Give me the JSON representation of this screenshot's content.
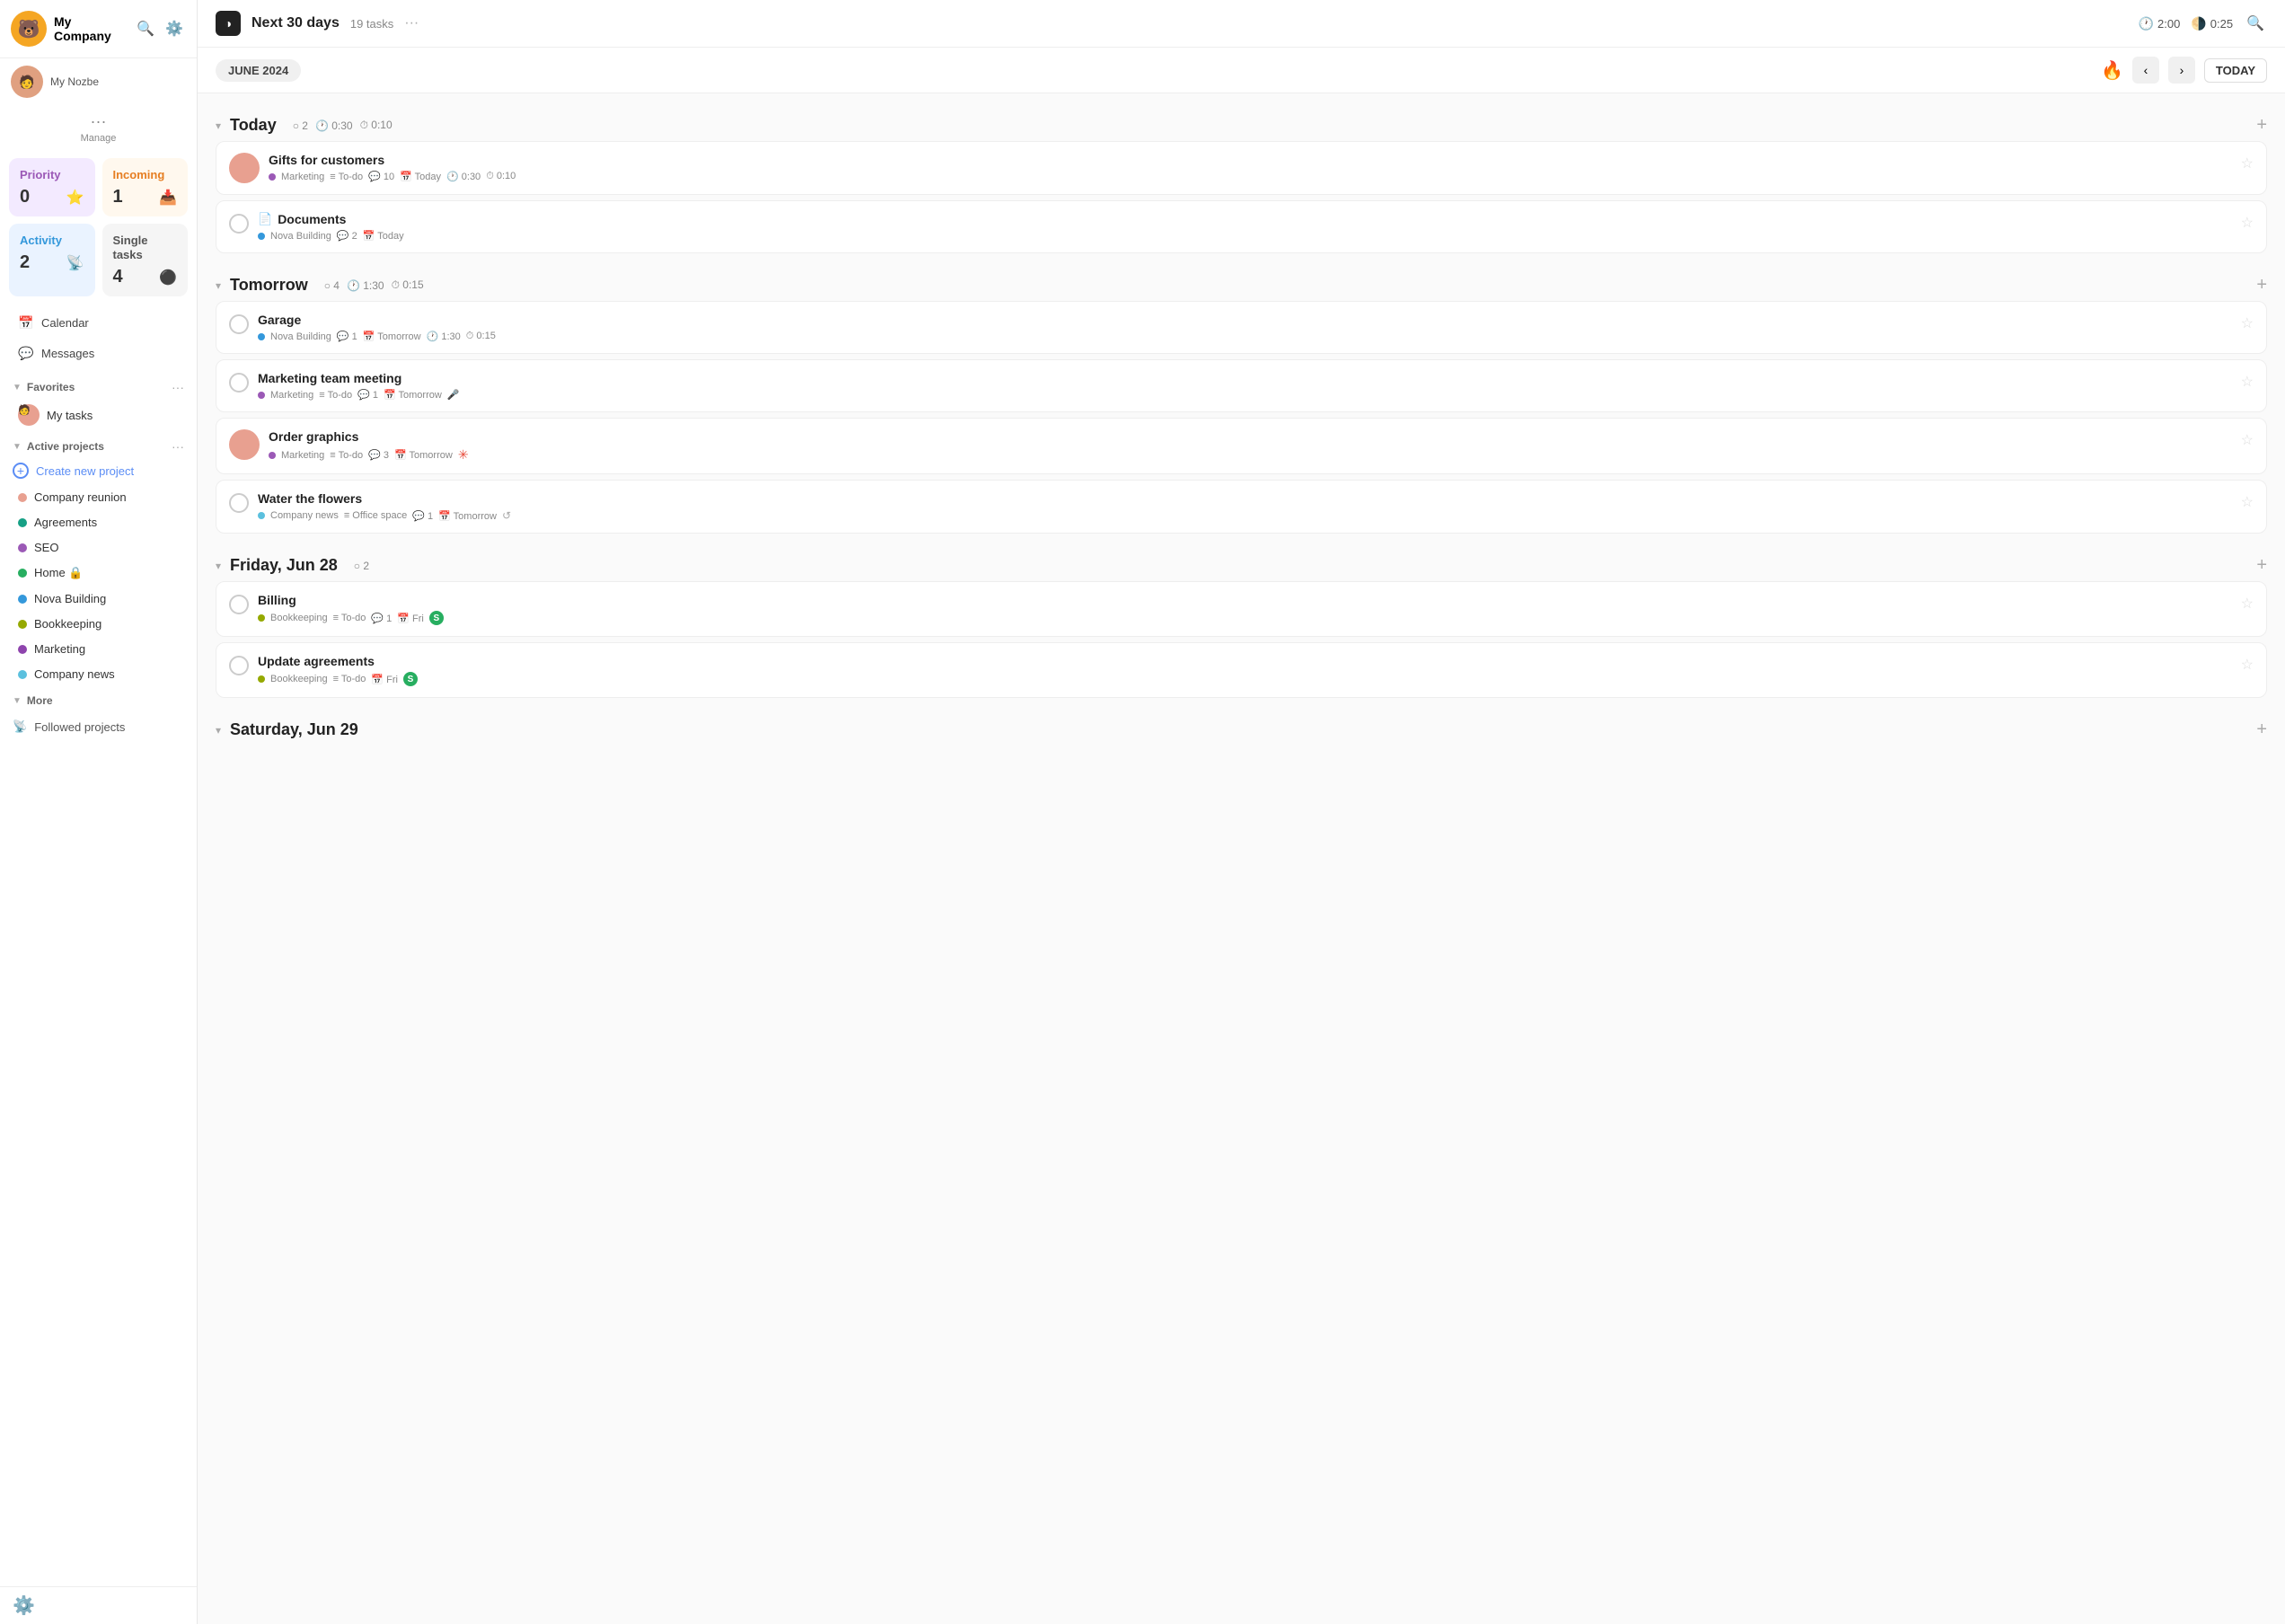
{
  "app": {
    "company": "My Company",
    "user": "My Nozbe",
    "manage_label": "Manage"
  },
  "stats": {
    "priority": {
      "label": "Priority",
      "value": "0",
      "icon": "⭐"
    },
    "incoming": {
      "label": "Incoming",
      "value": "1",
      "icon": "📥"
    },
    "activity": {
      "label": "Activity",
      "value": "2",
      "icon": "📡"
    },
    "single": {
      "label": "Single tasks",
      "value": "4",
      "icon": "⚫"
    }
  },
  "nav": {
    "calendar": "Calendar",
    "messages": "Messages"
  },
  "favorites": {
    "title": "Favorites",
    "my_tasks": "My tasks"
  },
  "active_projects": {
    "title": "Active projects",
    "create": "Create new project",
    "items": [
      {
        "name": "Company reunion",
        "color": "#e8a090"
      },
      {
        "name": "Agreements",
        "color": "#16a085"
      },
      {
        "name": "SEO",
        "color": "#9b59b6"
      },
      {
        "name": "Home",
        "color": "#27ae60",
        "lock": true
      },
      {
        "name": "Nova Building",
        "color": "#3498db"
      },
      {
        "name": "Bookkeeping",
        "color": "#95a900"
      },
      {
        "name": "Marketing",
        "color": "#8e44ad"
      },
      {
        "name": "Company news",
        "color": "#5bc0de"
      }
    ]
  },
  "more": {
    "title": "More",
    "followed": "Followed projects"
  },
  "header": {
    "icon": "◑",
    "title": "Next 30 days",
    "task_count": "19 tasks",
    "dots": "···",
    "timer1": "2:00",
    "timer2": "0:25"
  },
  "calendar_bar": {
    "month": "JUNE 2024",
    "today": "TODAY"
  },
  "sections": [
    {
      "id": "today",
      "title": "Today",
      "meta": {
        "tasks": "2",
        "time1": "0:30",
        "time2": "0:10"
      },
      "tasks": [
        {
          "id": "gifts",
          "has_avatar": true,
          "avatar_color": "#e8a090",
          "name": "Gifts for customers",
          "project_color": "#9b59b6",
          "project": "Marketing",
          "section": "To-do",
          "comments": "10",
          "date": "Today",
          "time1": "0:30",
          "time2": "0:10"
        },
        {
          "id": "documents",
          "has_avatar": false,
          "is_doc": true,
          "name": "Documents",
          "project_color": "#3498db",
          "project": "Nova Building",
          "section": null,
          "comments": "2",
          "date": "Today"
        }
      ]
    },
    {
      "id": "tomorrow",
      "title": "Tomorrow",
      "meta": {
        "tasks": "4",
        "time1": "1:30",
        "time2": "0:15"
      },
      "tasks": [
        {
          "id": "garage",
          "has_avatar": false,
          "name": "Garage",
          "project_color": "#3498db",
          "project": "Nova Building",
          "section": null,
          "comments": "1",
          "date": "Tomorrow",
          "time1": "1:30",
          "time2": "0:15"
        },
        {
          "id": "marketing-meeting",
          "has_avatar": false,
          "name": "Marketing team meeting",
          "project_color": "#9b59b6",
          "project": "Marketing",
          "section": "To-do",
          "comments": "1",
          "date": "Tomorrow",
          "has_mic": true
        },
        {
          "id": "order-graphics",
          "has_avatar": true,
          "avatar_color": "#e8a090",
          "name": "Order graphics",
          "project_color": "#9b59b6",
          "project": "Marketing",
          "section": "To-do",
          "comments": "3",
          "date": "Tomorrow",
          "has_asterisk": true
        },
        {
          "id": "water-flowers",
          "has_avatar": false,
          "name": "Water the flowers",
          "project_color": "#5bc0de",
          "project": "Company news",
          "section": "Office space",
          "comments": "1",
          "date": "Tomorrow",
          "has_refresh": true
        }
      ]
    },
    {
      "id": "friday-jun28",
      "title": "Friday, Jun 28",
      "meta": {
        "tasks": "2"
      },
      "tasks": [
        {
          "id": "billing",
          "has_avatar": false,
          "name": "Billing",
          "project_color": "#95a900",
          "project": "Bookkeeping",
          "section": "To-do",
          "comments": "1",
          "date": "Fri",
          "has_s": true
        },
        {
          "id": "update-agreements",
          "has_avatar": false,
          "name": "Update agreements",
          "project_color": "#95a900",
          "project": "Bookkeeping",
          "section": "To-do",
          "date": "Fri",
          "has_s": true
        }
      ]
    },
    {
      "id": "saturday-jun29",
      "title": "Saturday, Jun 29",
      "meta": {}
    }
  ]
}
